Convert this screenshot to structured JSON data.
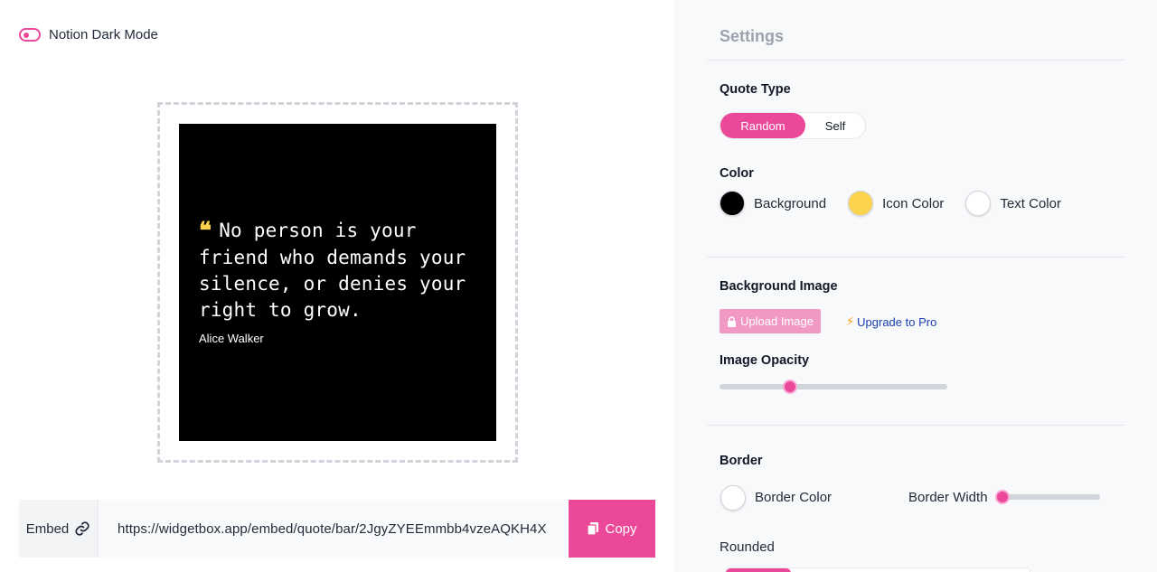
{
  "dark_mode": {
    "label": "Notion Dark Mode",
    "enabled": false
  },
  "preview": {
    "quote_mark": "❝",
    "quote": "No person is your friend who demands your silence, or denies your right to grow.",
    "author": "Alice Walker",
    "colors": {
      "background": "#000000",
      "icon": "#FCD34D",
      "text": "#FFFFFF"
    }
  },
  "embed": {
    "label": "Embed",
    "url": "https://widgetbox.app/embed/quote/bar/2JgyZYEEmmbb4vzeAQKH4X",
    "copy_label": "Copy",
    "icon": "link-icon"
  },
  "settings": {
    "title": "Settings",
    "quote_type": {
      "title": "Quote Type",
      "options": [
        "Random",
        "Self"
      ],
      "selected": "Random"
    },
    "color": {
      "title": "Color",
      "items": [
        {
          "label": "Background",
          "value": "#000000"
        },
        {
          "label": "Icon Color",
          "value": "#FCD34D"
        },
        {
          "label": "Text Color",
          "value": "#FFFFFF"
        }
      ]
    },
    "background_image": {
      "title": "Background Image",
      "upload_label": "Upload Image",
      "upgrade_label": "Upgrade to Pro"
    },
    "image_opacity": {
      "title": "Image Opacity",
      "value": 0.31
    },
    "border": {
      "title": "Border",
      "color_label": "Border Color",
      "color_value": "#FFFFFF",
      "width_label": "Border Width",
      "width_value": 0
    },
    "rounded": {
      "label": "Rounded"
    }
  },
  "accent": "#EC4899"
}
